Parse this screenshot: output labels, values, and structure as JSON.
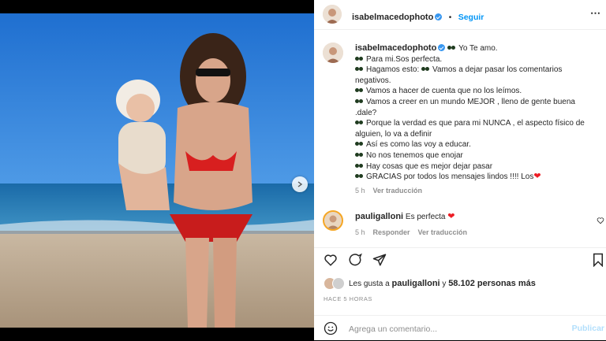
{
  "post": {
    "author": "isabelmacedophoto",
    "follow_label": "Seguir",
    "more_label": "⋯",
    "caption_lines": [
      {
        "glyph": true,
        "text": "Yo Te amo."
      },
      {
        "glyph": true,
        "text": "Para mi.Sos perfecta."
      },
      {
        "glyph": true,
        "text": "Hagamos esto: "
      },
      {
        "glyph": false,
        "text": "negativos."
      },
      {
        "glyph": true,
        "text": "Vamos a hacer de cuenta que no los leímos."
      },
      {
        "glyph": true,
        "text": "Vamos a creer en un mundo MEJOR , lleno de gente buena"
      },
      {
        "glyph": false,
        "text": ".dale?"
      },
      {
        "glyph": true,
        "text": "Porque la verdad es que para mi NUNCA , el aspecto físico de"
      },
      {
        "glyph": false,
        "text": "alguien, lo va a definir"
      },
      {
        "glyph": true,
        "text": "Así es como las voy a educar."
      },
      {
        "glyph": true,
        "text": "No nos tenemos que enojar"
      },
      {
        "glyph": true,
        "text": "Hay cosas que es mejor dejar pasar"
      },
      {
        "glyph": true,
        "text": "GRACIAS por todos los mensajes lindos !!!! Los"
      }
    ],
    "caption_line3_rest": "Vamos a dejar pasar los comentarios",
    "caption_time": "5 h",
    "translate_label": "Ver traducción"
  },
  "comment": {
    "author": "pauligalloni",
    "text": "Es perfecta",
    "time": "5 h",
    "reply_label": "Responder",
    "translate_label": "Ver traducción"
  },
  "likes": {
    "prefix": "Les gusta a",
    "user": "pauligalloni",
    "connector": "y",
    "count": "58.102 personas más"
  },
  "timestamp": "HACE 5 HORAS",
  "add_comment": {
    "placeholder": "Agrega un comentario...",
    "publish_label": "Publicar"
  },
  "colors": {
    "accent": "#0095f6",
    "heart": "#ed1c24",
    "publish_disabled": "#b2dffc"
  }
}
